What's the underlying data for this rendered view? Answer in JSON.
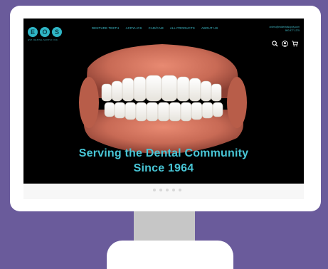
{
  "logo": {
    "letters": [
      "E",
      "O",
      "S"
    ],
    "tagline": "EST. DENTAL SUPPLY, INC."
  },
  "nav": {
    "items": [
      "DENTURE TEETH",
      "ACRYLICS",
      "CAD/CAM",
      "ALL PRODUCTS",
      "ABOUT US"
    ]
  },
  "contact": {
    "email": "orders@estdentalsupply.com",
    "phone": "800.877.1275"
  },
  "icons": {
    "search": "search-icon",
    "account": "user-icon",
    "cart": "cart-icon"
  },
  "hero": {
    "line1": "Serving the Dental Community",
    "line2": "Since 1964"
  },
  "slider": {
    "dot_count": 5
  },
  "colors": {
    "background": "#6a5b9b",
    "accent": "#3fc0ce",
    "header": "#000000"
  }
}
